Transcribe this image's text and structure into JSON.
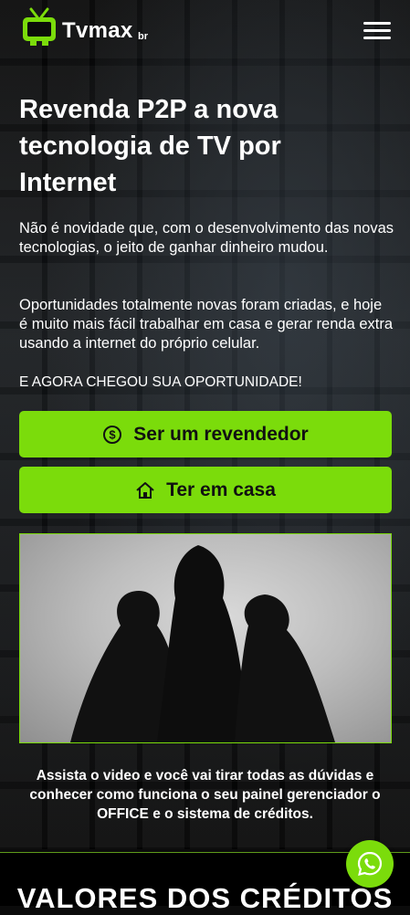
{
  "brand": {
    "name": "Tvmax",
    "suffix": "br",
    "accent": "#7bdc0b"
  },
  "header": {
    "menu_icon": "hamburger-menu-icon"
  },
  "hero": {
    "title": "Revenda P2P a nova tecnologia de TV por Internet",
    "paragraph1": "Não é novidade que, com o desenvolvimento das novas tecnologias, o jeito de ganhar dinheiro mudou.",
    "paragraph2": "Oportunidades totalmente novas foram criadas, e hoje é muito mais fácil trabalhar em casa e gerar renda extra usando a internet do próprio celular.",
    "paragraph3": "E AGORA CHEGOU SUA OPORTUNIDADE!"
  },
  "buttons": {
    "reseller": {
      "label": "Ser um revendedor",
      "icon": "dollar-coin-icon"
    },
    "home": {
      "label": "Ter em casa",
      "icon": "home-icon"
    }
  },
  "video": {
    "caption": "Assista o video e você vai tirar todas as dúvidas e conhecer como funciona o seu painel gerenciador o OFFICE e o sistema de créditos."
  },
  "section": {
    "title": "VALORES DOS CRÉDITOS"
  },
  "whatsapp": {
    "icon": "whatsapp-icon"
  }
}
